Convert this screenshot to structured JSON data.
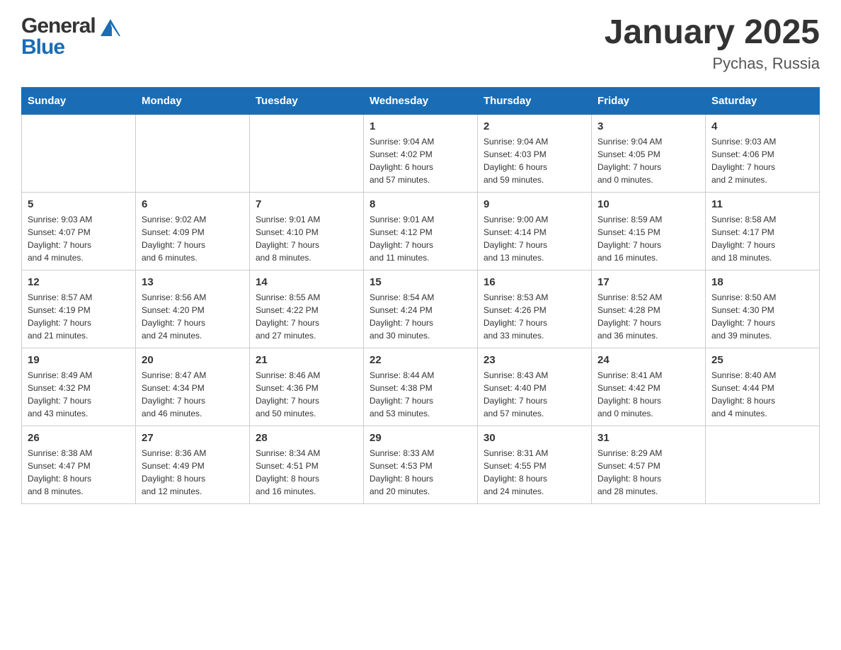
{
  "header": {
    "logo_general": "General",
    "logo_blue": "Blue",
    "title": "January 2025",
    "subtitle": "Pychas, Russia"
  },
  "weekdays": [
    "Sunday",
    "Monday",
    "Tuesday",
    "Wednesday",
    "Thursday",
    "Friday",
    "Saturday"
  ],
  "weeks": [
    [
      {
        "day": "",
        "info": ""
      },
      {
        "day": "",
        "info": ""
      },
      {
        "day": "",
        "info": ""
      },
      {
        "day": "1",
        "info": "Sunrise: 9:04 AM\nSunset: 4:02 PM\nDaylight: 6 hours\nand 57 minutes."
      },
      {
        "day": "2",
        "info": "Sunrise: 9:04 AM\nSunset: 4:03 PM\nDaylight: 6 hours\nand 59 minutes."
      },
      {
        "day": "3",
        "info": "Sunrise: 9:04 AM\nSunset: 4:05 PM\nDaylight: 7 hours\nand 0 minutes."
      },
      {
        "day": "4",
        "info": "Sunrise: 9:03 AM\nSunset: 4:06 PM\nDaylight: 7 hours\nand 2 minutes."
      }
    ],
    [
      {
        "day": "5",
        "info": "Sunrise: 9:03 AM\nSunset: 4:07 PM\nDaylight: 7 hours\nand 4 minutes."
      },
      {
        "day": "6",
        "info": "Sunrise: 9:02 AM\nSunset: 4:09 PM\nDaylight: 7 hours\nand 6 minutes."
      },
      {
        "day": "7",
        "info": "Sunrise: 9:01 AM\nSunset: 4:10 PM\nDaylight: 7 hours\nand 8 minutes."
      },
      {
        "day": "8",
        "info": "Sunrise: 9:01 AM\nSunset: 4:12 PM\nDaylight: 7 hours\nand 11 minutes."
      },
      {
        "day": "9",
        "info": "Sunrise: 9:00 AM\nSunset: 4:14 PM\nDaylight: 7 hours\nand 13 minutes."
      },
      {
        "day": "10",
        "info": "Sunrise: 8:59 AM\nSunset: 4:15 PM\nDaylight: 7 hours\nand 16 minutes."
      },
      {
        "day": "11",
        "info": "Sunrise: 8:58 AM\nSunset: 4:17 PM\nDaylight: 7 hours\nand 18 minutes."
      }
    ],
    [
      {
        "day": "12",
        "info": "Sunrise: 8:57 AM\nSunset: 4:19 PM\nDaylight: 7 hours\nand 21 minutes."
      },
      {
        "day": "13",
        "info": "Sunrise: 8:56 AM\nSunset: 4:20 PM\nDaylight: 7 hours\nand 24 minutes."
      },
      {
        "day": "14",
        "info": "Sunrise: 8:55 AM\nSunset: 4:22 PM\nDaylight: 7 hours\nand 27 minutes."
      },
      {
        "day": "15",
        "info": "Sunrise: 8:54 AM\nSunset: 4:24 PM\nDaylight: 7 hours\nand 30 minutes."
      },
      {
        "day": "16",
        "info": "Sunrise: 8:53 AM\nSunset: 4:26 PM\nDaylight: 7 hours\nand 33 minutes."
      },
      {
        "day": "17",
        "info": "Sunrise: 8:52 AM\nSunset: 4:28 PM\nDaylight: 7 hours\nand 36 minutes."
      },
      {
        "day": "18",
        "info": "Sunrise: 8:50 AM\nSunset: 4:30 PM\nDaylight: 7 hours\nand 39 minutes."
      }
    ],
    [
      {
        "day": "19",
        "info": "Sunrise: 8:49 AM\nSunset: 4:32 PM\nDaylight: 7 hours\nand 43 minutes."
      },
      {
        "day": "20",
        "info": "Sunrise: 8:47 AM\nSunset: 4:34 PM\nDaylight: 7 hours\nand 46 minutes."
      },
      {
        "day": "21",
        "info": "Sunrise: 8:46 AM\nSunset: 4:36 PM\nDaylight: 7 hours\nand 50 minutes."
      },
      {
        "day": "22",
        "info": "Sunrise: 8:44 AM\nSunset: 4:38 PM\nDaylight: 7 hours\nand 53 minutes."
      },
      {
        "day": "23",
        "info": "Sunrise: 8:43 AM\nSunset: 4:40 PM\nDaylight: 7 hours\nand 57 minutes."
      },
      {
        "day": "24",
        "info": "Sunrise: 8:41 AM\nSunset: 4:42 PM\nDaylight: 8 hours\nand 0 minutes."
      },
      {
        "day": "25",
        "info": "Sunrise: 8:40 AM\nSunset: 4:44 PM\nDaylight: 8 hours\nand 4 minutes."
      }
    ],
    [
      {
        "day": "26",
        "info": "Sunrise: 8:38 AM\nSunset: 4:47 PM\nDaylight: 8 hours\nand 8 minutes."
      },
      {
        "day": "27",
        "info": "Sunrise: 8:36 AM\nSunset: 4:49 PM\nDaylight: 8 hours\nand 12 minutes."
      },
      {
        "day": "28",
        "info": "Sunrise: 8:34 AM\nSunset: 4:51 PM\nDaylight: 8 hours\nand 16 minutes."
      },
      {
        "day": "29",
        "info": "Sunrise: 8:33 AM\nSunset: 4:53 PM\nDaylight: 8 hours\nand 20 minutes."
      },
      {
        "day": "30",
        "info": "Sunrise: 8:31 AM\nSunset: 4:55 PM\nDaylight: 8 hours\nand 24 minutes."
      },
      {
        "day": "31",
        "info": "Sunrise: 8:29 AM\nSunset: 4:57 PM\nDaylight: 8 hours\nand 28 minutes."
      },
      {
        "day": "",
        "info": ""
      }
    ]
  ]
}
